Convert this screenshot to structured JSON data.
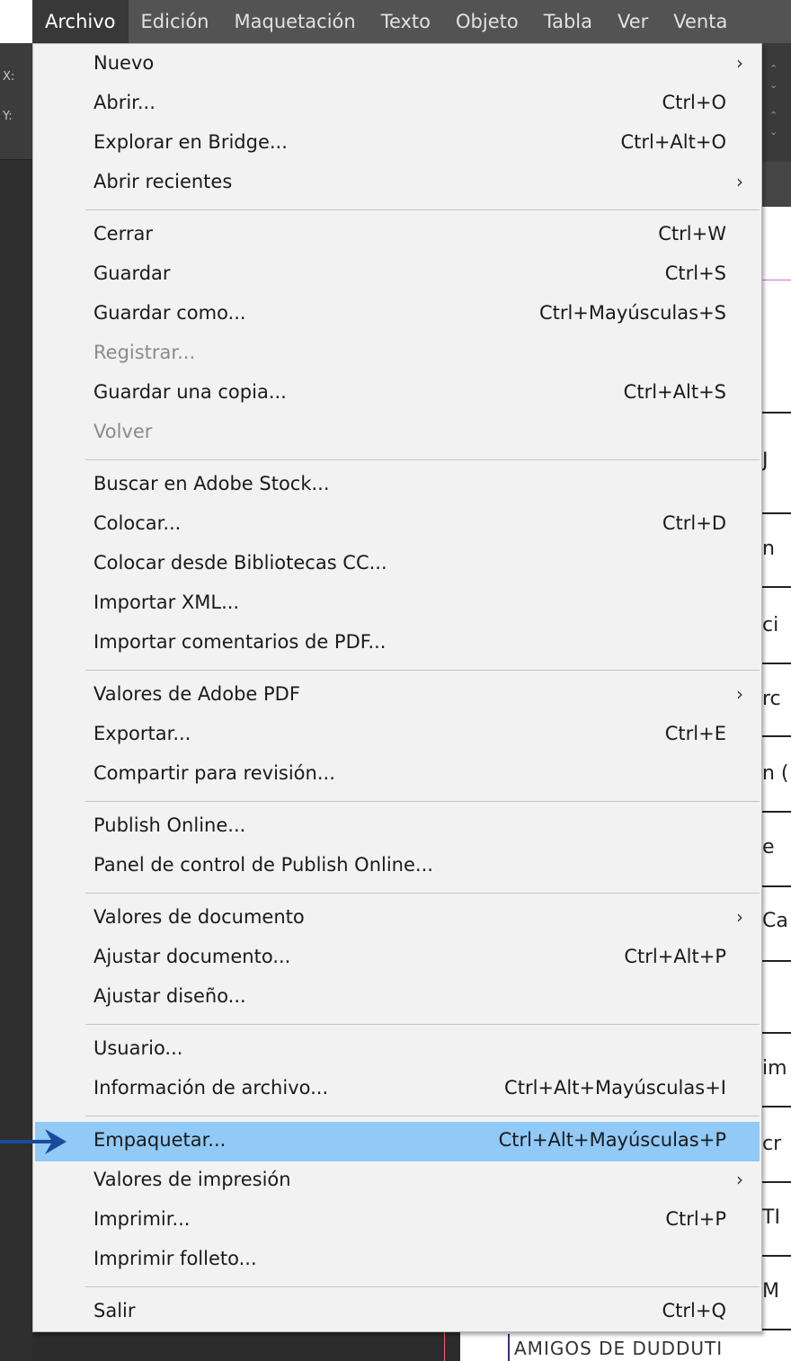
{
  "colors": {
    "menubar": "#535353",
    "menubar_active": "#383838",
    "menu_bg": "#f2f2f2",
    "highlight": "#91c9f7",
    "separator": "#c4c4c4",
    "pointer_arrow": "#1a4a9c"
  },
  "menubar": {
    "items": [
      {
        "label": "Archivo",
        "active": true
      },
      {
        "label": "Edición"
      },
      {
        "label": "Maquetación"
      },
      {
        "label": "Texto"
      },
      {
        "label": "Objeto"
      },
      {
        "label": "Tabla"
      },
      {
        "label": "Ver"
      },
      {
        "label": "Venta"
      }
    ]
  },
  "background": {
    "tool_marks": [
      "X:",
      "Y:"
    ],
    "doc_fragments": [
      "J",
      "n",
      "ci",
      "rc",
      "n (",
      "e",
      "Ca",
      "im",
      "cr",
      "TI",
      "M"
    ],
    "bottom_text": "AMIGOS DE DUDDUTI"
  },
  "menu": {
    "groups": [
      [
        {
          "label": "Nuevo",
          "submenu": true
        },
        {
          "label": "Abrir...",
          "shortcut": "Ctrl+O"
        },
        {
          "label": "Explorar en Bridge...",
          "shortcut": "Ctrl+Alt+O"
        },
        {
          "label": "Abrir recientes",
          "submenu": true
        }
      ],
      [
        {
          "label": "Cerrar",
          "shortcut": "Ctrl+W"
        },
        {
          "label": "Guardar",
          "shortcut": "Ctrl+S"
        },
        {
          "label": "Guardar como...",
          "shortcut": "Ctrl+Mayúsculas+S"
        },
        {
          "label": "Registrar...",
          "disabled": true
        },
        {
          "label": "Guardar una copia...",
          "shortcut": "Ctrl+Alt+S"
        },
        {
          "label": "Volver",
          "disabled": true
        }
      ],
      [
        {
          "label": "Buscar en Adobe Stock..."
        },
        {
          "label": "Colocar...",
          "shortcut": "Ctrl+D"
        },
        {
          "label": "Colocar desde Bibliotecas CC..."
        },
        {
          "label": "Importar XML..."
        },
        {
          "label": "Importar comentarios de PDF..."
        }
      ],
      [
        {
          "label": "Valores de Adobe PDF",
          "submenu": true
        },
        {
          "label": "Exportar...",
          "shortcut": "Ctrl+E"
        },
        {
          "label": "Compartir para revisión..."
        }
      ],
      [
        {
          "label": "Publish Online..."
        },
        {
          "label": "Panel de control de Publish Online..."
        }
      ],
      [
        {
          "label": "Valores de documento",
          "submenu": true
        },
        {
          "label": "Ajustar documento...",
          "shortcut": "Ctrl+Alt+P"
        },
        {
          "label": "Ajustar diseño..."
        }
      ],
      [
        {
          "label": "Usuario..."
        },
        {
          "label": "Información de archivo...",
          "shortcut": "Ctrl+Alt+Mayúsculas+I"
        }
      ],
      [
        {
          "label": "Empaquetar...",
          "shortcut": "Ctrl+Alt+Mayúsculas+P",
          "highlighted": true
        },
        {
          "label": "Valores de impresión",
          "submenu": true
        },
        {
          "label": "Imprimir...",
          "shortcut": "Ctrl+P"
        },
        {
          "label": "Imprimir folleto..."
        }
      ],
      [
        {
          "label": "Salir",
          "shortcut": "Ctrl+Q"
        }
      ]
    ]
  }
}
